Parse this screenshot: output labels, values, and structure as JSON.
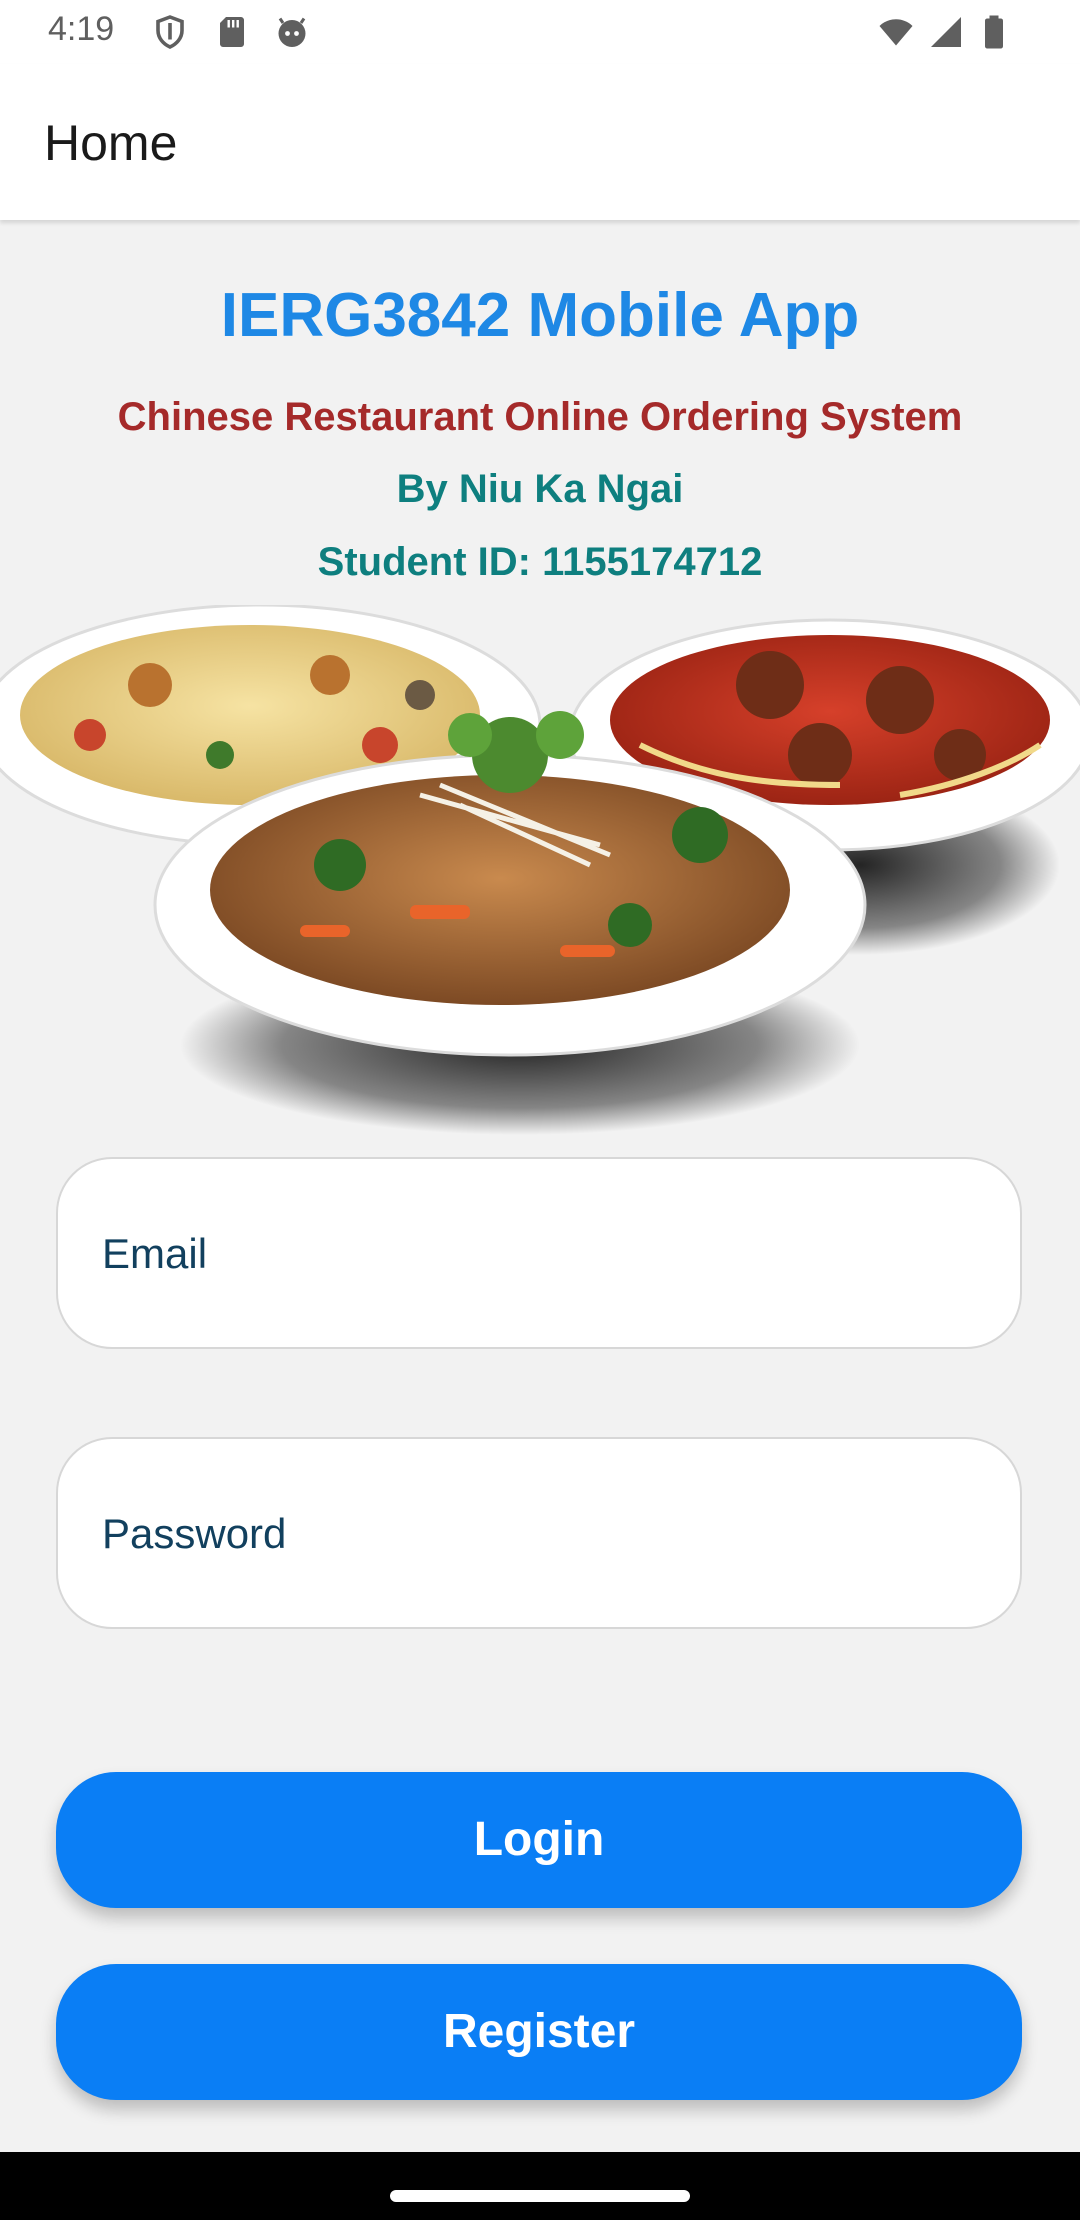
{
  "status_bar": {
    "time": "4:19",
    "left_icons": [
      "shield-icon",
      "sd-card-icon",
      "android-face-icon"
    ],
    "right_icons": [
      "wifi-icon",
      "signal-icon",
      "battery-icon"
    ]
  },
  "app_bar": {
    "title": "Home"
  },
  "header": {
    "title": "IERG3842 Mobile App",
    "subtitle": "Chinese Restaurant Online Ordering System",
    "author": "By Niu Ka Ngai",
    "student_id": "Student ID: 1155174712"
  },
  "food_image": {
    "description_icon": "food-plates-image"
  },
  "form": {
    "email_placeholder": "Email",
    "email_value": "",
    "password_placeholder": "Password",
    "password_value": ""
  },
  "buttons": {
    "login_label": "Login",
    "register_label": "Register"
  },
  "colors": {
    "title_blue": "#1e88e5",
    "subtitle_red": "#a52a2a",
    "teal": "#0e7f7f",
    "button_blue": "#0a7ef5",
    "background": "#f2f2f2"
  }
}
